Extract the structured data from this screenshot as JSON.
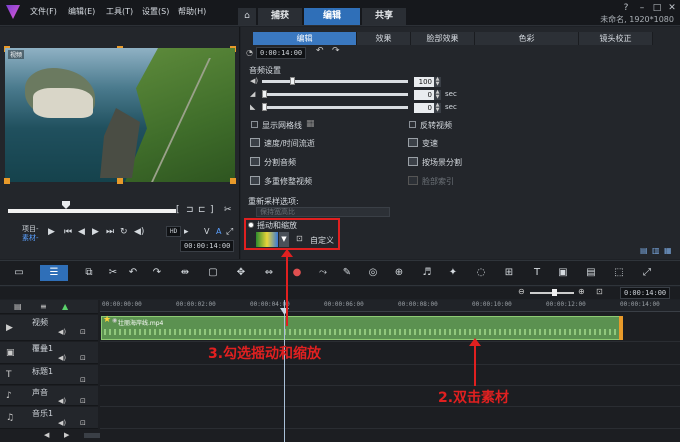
{
  "titlebar": {
    "menus": [
      "文件(F)",
      "编辑(E)",
      "工具(T)",
      "设置(S)",
      "帮助(H)"
    ],
    "tabs": [
      "捕获",
      "编辑",
      "共享"
    ],
    "project_info": "未命名, 1920*1080"
  },
  "preview": {
    "clip_label": "视频",
    "project_label": "项目-",
    "clip_mode_label": "素材-",
    "hd_label": "HD",
    "timecode": "00:00:14:00",
    "mode_letters": [
      "V",
      "A"
    ]
  },
  "edit_panel": {
    "subtabs": [
      "编辑",
      "效果",
      "脸部效果",
      "色彩",
      "镜头校正"
    ],
    "timecode": "0:00:14:00",
    "audio_settings_label": "音频设置",
    "volume_value": "100",
    "fade_in_value": "0",
    "fade_out_value": "0",
    "sec_label": "sec",
    "options": {
      "show_grid": "显示网格线",
      "reverse": "反转视频",
      "speed_time": "速度/时间流逝",
      "variable_speed": "变速",
      "split_audio": "分割音频",
      "scene_split": "按场景分割",
      "multi_trim": "多重修整视频",
      "face_index": "脸部索引"
    },
    "resample_label": "重新采样选项:",
    "resample_select": "保持宽高比",
    "pan_zoom_label": "摇动和缩放",
    "custom_label": "自定义"
  },
  "timeline": {
    "ruler": [
      "00:00:00:00",
      "00:00:02:00",
      "00:00:04:00",
      "00:00:06:00",
      "00:00:08:00",
      "00:00:10:00",
      "00:00:12:00",
      "00:00:14:00"
    ],
    "zoom_timecode": "0:00:14:00",
    "tracks": [
      "视频",
      "覆叠1",
      "标题1",
      "声音",
      "音乐1"
    ],
    "clip_name": "壮丽海岸线.mp4"
  },
  "annotations": {
    "step3": "3.勾选摇动和缩放",
    "step2": "2.双击素材"
  },
  "colors": {
    "accent": "#2f6fb8",
    "clip": "#5b9150",
    "annotation": "#e02020",
    "handle": "#e89a2a"
  }
}
